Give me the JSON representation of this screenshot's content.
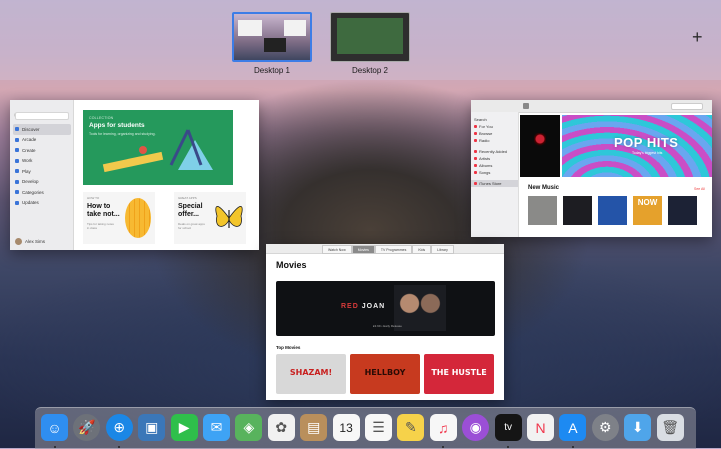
{
  "spaces": {
    "items": [
      {
        "label": "Desktop 1",
        "active": true
      },
      {
        "label": "Desktop 2",
        "active": false
      }
    ],
    "add_label": "+"
  },
  "appstore": {
    "nav": [
      {
        "label": "Discover",
        "selected": true
      },
      {
        "label": "Arcade"
      },
      {
        "label": "Create"
      },
      {
        "label": "Work"
      },
      {
        "label": "Play"
      },
      {
        "label": "Develop"
      },
      {
        "label": "Categories"
      },
      {
        "label": "Updates"
      }
    ],
    "user": "Alex Sims",
    "hero": {
      "kicker": "COLLECTION",
      "title": "Apps for students",
      "subtitle": "Tools for learning, organizing and studying."
    },
    "card1": {
      "kicker": "HOW TO",
      "title": "How to take not...",
      "subtitle": "Tips for taking notes in class"
    },
    "card2": {
      "kicker": "GREAT APPS",
      "title": "Special offer...",
      "subtitle": "Deals on great apps for school"
    }
  },
  "music": {
    "sidebar": [
      {
        "label": "Search"
      },
      {
        "label": "For You"
      },
      {
        "label": "Browse"
      },
      {
        "label": "Radio"
      },
      {
        "label": "Recently Added"
      },
      {
        "label": "Artists"
      },
      {
        "label": "Albums"
      },
      {
        "label": "Songs"
      },
      {
        "label": "iTunes Store",
        "selected": true
      }
    ],
    "hero_title": "POP HITS",
    "hero_sub": "Today's biggest hits",
    "section": "New Music",
    "see_all": "See All",
    "albums": [
      "Album 1",
      "Album 2",
      "Album 3",
      "NOW",
      "Album 5"
    ]
  },
  "tv": {
    "tabs": [
      {
        "label": "Watch Now"
      },
      {
        "label": "Movies",
        "selected": true
      },
      {
        "label": "TV Programmes"
      },
      {
        "label": "Kids"
      },
      {
        "label": "Library"
      }
    ],
    "title": "Movies",
    "hero": {
      "word1": "RED",
      "word2": "JOAN",
      "caption": "£3.99 • Early Release"
    },
    "top_movies_label": "Top Movies",
    "posters": [
      {
        "title": "SHAZAM!",
        "color": "#d8d8d8"
      },
      {
        "title": "HELLBOY",
        "color": "#c73a1f"
      },
      {
        "title": "THE HUSTLE",
        "color": "#d4273a"
      }
    ]
  },
  "dock": {
    "apps": [
      {
        "name": "finder-icon",
        "glyph": "☺",
        "color": "#2f8ef0",
        "dot": true
      },
      {
        "name": "launchpad-icon",
        "glyph": "🚀",
        "color": "#6d7179"
      },
      {
        "name": "safari-icon",
        "glyph": "⊕",
        "color": "#1b87e6",
        "dot": true
      },
      {
        "name": "photo-booth-icon",
        "glyph": "▣",
        "color": "#3b77b8"
      },
      {
        "name": "facetime-icon",
        "glyph": "▶",
        "color": "#2fbf4b"
      },
      {
        "name": "messages-icon",
        "glyph": "✉",
        "color": "#3ea3f5"
      },
      {
        "name": "maps-icon",
        "glyph": "◈",
        "color": "#58b35d"
      },
      {
        "name": "photos-icon",
        "glyph": "✿",
        "color": "#f1f1f1"
      },
      {
        "name": "contacts-icon",
        "glyph": "▤",
        "color": "#b98f5c"
      },
      {
        "name": "calendar-icon",
        "glyph": "13",
        "color": "#f7f7f7"
      },
      {
        "name": "reminders-icon",
        "glyph": "☰",
        "color": "#f7f7f7"
      },
      {
        "name": "notes-icon",
        "glyph": "✎",
        "color": "#f6d24a"
      },
      {
        "name": "music-icon",
        "glyph": "♫",
        "color": "#f7f7f7",
        "dot": true
      },
      {
        "name": "podcasts-icon",
        "glyph": "◉",
        "color": "#9b4fd6"
      },
      {
        "name": "tv-icon",
        "glyph": "tv",
        "color": "#151515",
        "dot": true
      },
      {
        "name": "news-icon",
        "glyph": "N",
        "color": "#f2f2f2"
      },
      {
        "name": "app-store-icon",
        "glyph": "A",
        "color": "#1d8af2",
        "dot": true
      },
      {
        "name": "system-preferences-icon",
        "glyph": "⚙",
        "color": "#7e8188"
      },
      {
        "name": "downloads-folder-icon",
        "glyph": "⬇",
        "color": "#4fa5ea"
      },
      {
        "name": "trash-icon",
        "glyph": "🗑",
        "color": "#d9dde3"
      }
    ]
  }
}
